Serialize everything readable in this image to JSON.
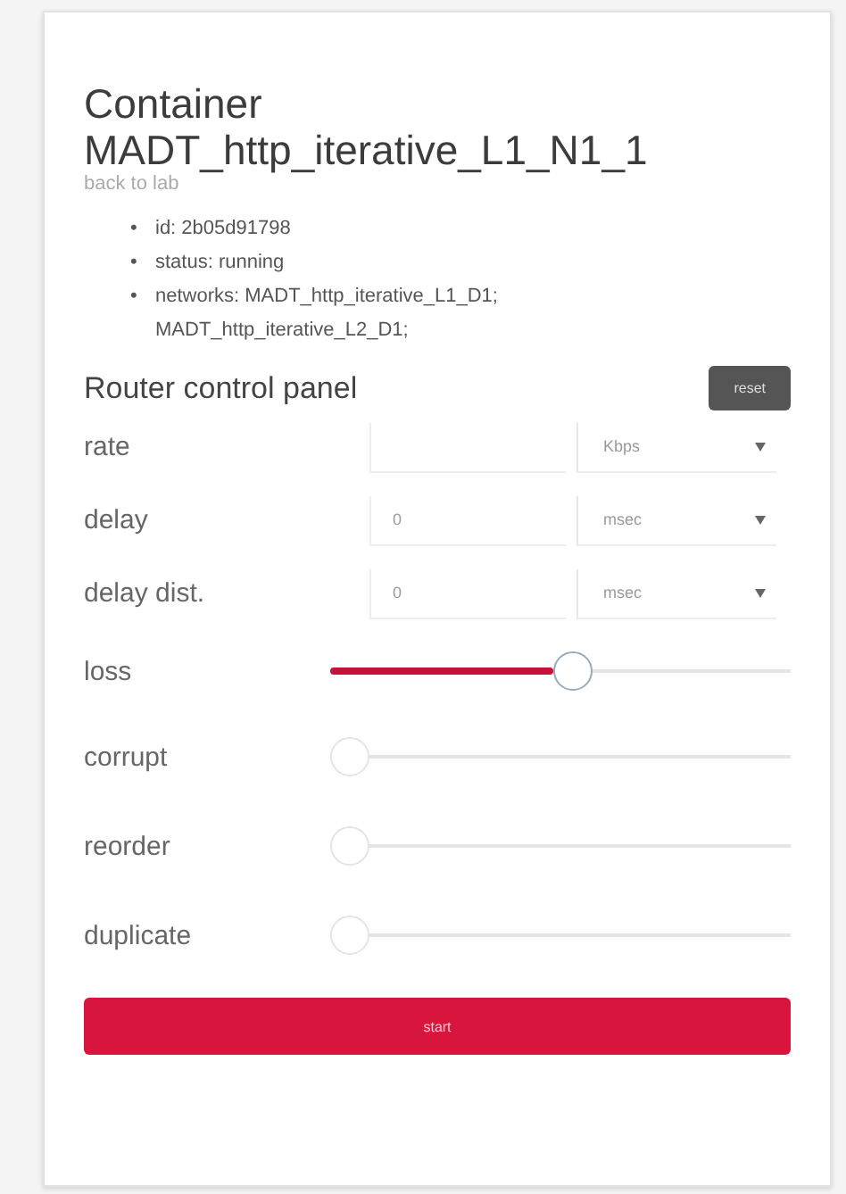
{
  "title_lines": [
    "Container",
    "MADT_http_iterative_L1_N1_1"
  ],
  "back_link": "back to lab",
  "details": [
    {
      "bullet": "•",
      "text": "id: 2b05d91798"
    },
    {
      "bullet": "•",
      "text": "status: running"
    },
    {
      "bullet": "•",
      "text": "networks: MADT_http_iterative_L1_D1; MADT_http_iterative_L2_D1;"
    }
  ],
  "panel": {
    "title": "Router control panel",
    "reset_button": "reset"
  },
  "controls": [
    {
      "kind": "field",
      "label": "rate",
      "unit": "Kbps"
    },
    {
      "kind": "field",
      "label": "delay",
      "value": "0",
      "unit": "msec"
    },
    {
      "kind": "field",
      "label": "delay dist.",
      "value": "0",
      "unit": "msec"
    },
    {
      "kind": "slider",
      "label": "loss",
      "level": 0.53
    },
    {
      "kind": "slider",
      "label": "corrupt",
      "level": 0
    },
    {
      "kind": "slider",
      "label": "reorder",
      "level": 0
    },
    {
      "kind": "slider",
      "label": "duplicate",
      "level": 0
    }
  ],
  "submit_button": "start"
}
